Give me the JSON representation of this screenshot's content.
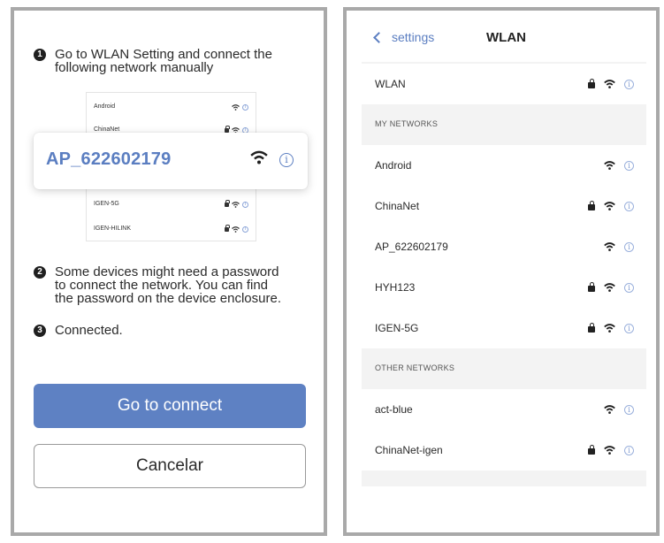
{
  "left_screen": {
    "step1": {
      "number": "1",
      "text": "Go to WLAN Setting and connect the\nfollowing network manually"
    },
    "mini_list": [
      {
        "ssid": "Android",
        "locked": false
      },
      {
        "ssid": "ChinaNet",
        "locked": true
      },
      {
        "ssid": "IGEN-5G",
        "locked": true
      },
      {
        "ssid": "IGEN-HILINK",
        "locked": true
      }
    ],
    "popup": {
      "ssid": "AP_622602179",
      "info_glyph": "i"
    },
    "step2": {
      "number": "2",
      "text": "Some devices might need a password\nto connect the network. You can find\nthe password on the device enclosure."
    },
    "step3": {
      "number": "3",
      "text": "Connected."
    },
    "go_button": "Go to connect",
    "cancel_button": "Cancelar",
    "accent_color": "#5e81c3"
  },
  "right_screen": {
    "back_label": "settings",
    "title": "WLAN",
    "wlan_row": {
      "label": "WLAN",
      "locked": true
    },
    "my_networks_header": "MY NETWORKS",
    "my_networks": [
      {
        "ssid": "Android",
        "locked": false
      },
      {
        "ssid": "ChinaNet",
        "locked": true
      },
      {
        "ssid": "AP_622602179",
        "locked": false
      },
      {
        "ssid": "HYH123",
        "locked": true
      },
      {
        "ssid": "IGEN-5G",
        "locked": true
      }
    ],
    "other_networks_header": "OTHER  NETWORKS",
    "other_networks": [
      {
        "ssid": "act-blue",
        "locked": false
      },
      {
        "ssid": "ChinaNet-igen",
        "locked": true
      }
    ],
    "info_glyph": "i"
  }
}
